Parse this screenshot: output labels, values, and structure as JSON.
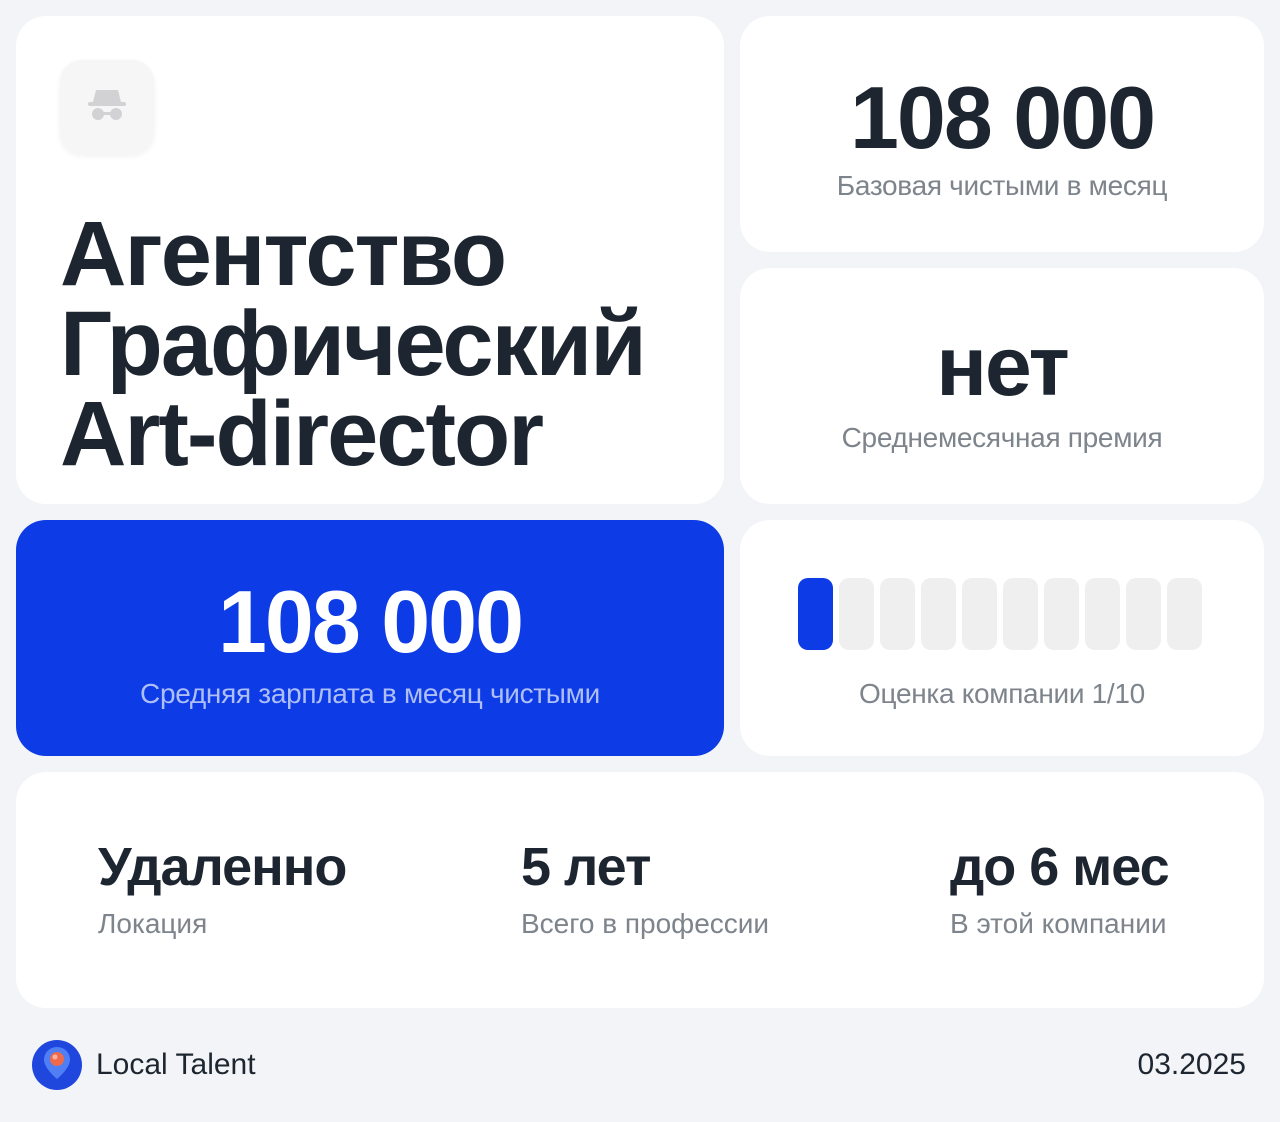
{
  "title_card": {
    "icon": "incognito-icon",
    "lines": [
      "Агентство",
      "Графический",
      "Art-director"
    ]
  },
  "base_salary": {
    "value": "108 000",
    "label": "Базовая чистыми в месяц"
  },
  "bonus": {
    "value": "нет",
    "label": "Среднемесячная премия"
  },
  "average_salary": {
    "value": "108 000",
    "label": "Средняя зарплата в месяц чистыми"
  },
  "rating": {
    "score": 1,
    "max": 10,
    "label": "Оценка компании 1/10"
  },
  "stats": [
    {
      "value": "Удаленно",
      "label": "Локация"
    },
    {
      "value": "5 лет",
      "label": "Всего в профессии"
    },
    {
      "value": "до 6 мес",
      "label": "В этой компании"
    }
  ],
  "footer": {
    "logo_icon": "map-pin-icon",
    "brand": "Local Talent",
    "date": "03.2025"
  },
  "colors": {
    "accent": "#0d3ce6",
    "background": "#f3f4f7",
    "text": "#1d2630",
    "muted": "#7d848c"
  }
}
